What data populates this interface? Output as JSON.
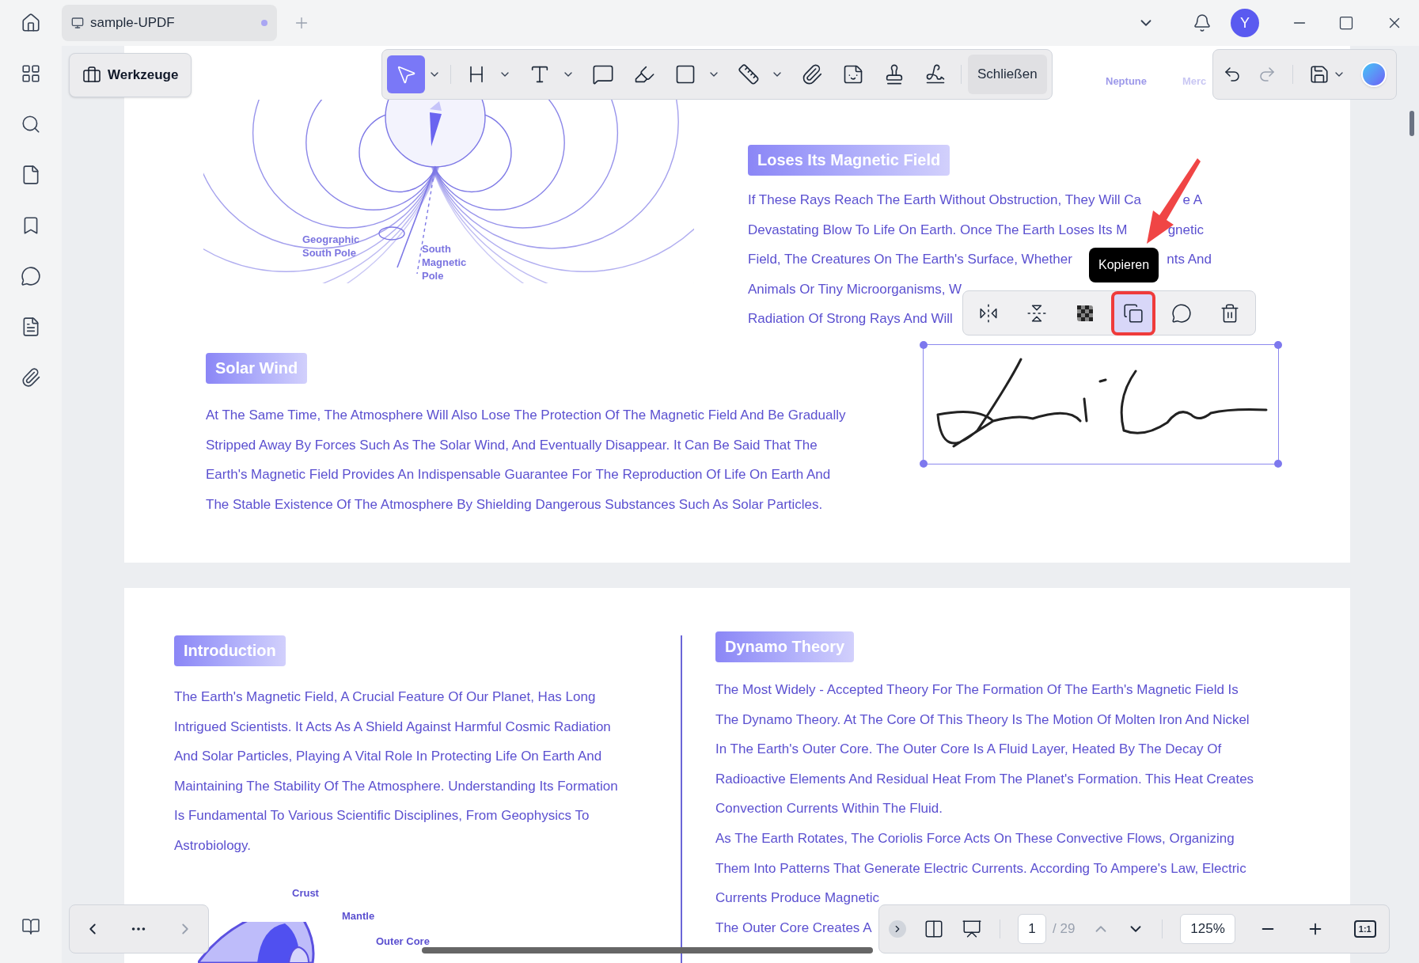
{
  "tab": {
    "title": "sample-UPDF",
    "unsaved": true
  },
  "avatar": {
    "initial": "Y"
  },
  "sidebar": {
    "items": [
      {
        "kind": "grid"
      },
      {
        "kind": "search"
      },
      {
        "kind": "page"
      },
      {
        "kind": "bookmark"
      },
      {
        "kind": "comment"
      },
      {
        "kind": "form"
      },
      {
        "kind": "attachment"
      }
    ]
  },
  "tools_button": {
    "label": "Werkzeuge"
  },
  "toolbar": {
    "tools": [
      {
        "kind": "select",
        "selected": true,
        "dropdown": true
      },
      {
        "kind": "heading",
        "selected": false,
        "dropdown": true
      },
      {
        "kind": "text",
        "selected": false,
        "dropdown": true
      },
      {
        "kind": "comment",
        "selected": false,
        "dropdown": false
      },
      {
        "kind": "highlighter",
        "selected": false,
        "dropdown": false
      },
      {
        "kind": "shape",
        "selected": false,
        "dropdown": true
      },
      {
        "kind": "measure",
        "selected": false,
        "dropdown": true
      },
      {
        "kind": "attachment",
        "selected": false,
        "dropdown": false
      },
      {
        "kind": "sticker",
        "selected": false,
        "dropdown": false
      },
      {
        "kind": "stamp",
        "selected": false,
        "dropdown": false
      },
      {
        "kind": "signature",
        "selected": false,
        "dropdown": false
      }
    ],
    "close_label": "Schließen"
  },
  "background_labels": [
    "Neptune",
    "Merc"
  ],
  "page1": {
    "diagram_labels": [
      "Geographic South Pole",
      "South Magnetic Pole"
    ],
    "right_heading": "Loses Its Magnetic Field",
    "right_lines": [
      {
        "text": "If These Rays Reach The Earth Without Obstruction, They Will Ca",
        "tail": "e A"
      },
      {
        "text": "Devastating Blow To Life On Earth. Once The Earth Loses Its M",
        "tail": "gnetic"
      },
      {
        "text": "Field, The Creatures On The Earth's Surface, Whether",
        "tail": "nts And"
      },
      {
        "text": "Animals Or Tiny Microorganisms, W"
      },
      {
        "text": "Radiation Of Strong Rays And Will"
      }
    ],
    "left_heading": "Solar Wind",
    "left_lines": [
      "At The Same Time, The Atmosphere Will Also Lose The Protection Of The Magnetic Field And Be Gradually",
      "Stripped Away By Forces Such As The Solar Wind, And Eventually Disappear. It Can Be Said That The",
      "Earth's Magnetic Field Provides An Indispensable Guarantee For The Reproduction Of Life On Earth And",
      "The Stable Existence Of The Atmosphere By Shielding Dangerous Substances Such As Solar Particles."
    ]
  },
  "selection_toolbar": {
    "actions": [
      {
        "kind": "flip-horizontal",
        "selected": false
      },
      {
        "kind": "flip-vertical",
        "selected": false
      },
      {
        "kind": "opacity",
        "selected": false
      },
      {
        "kind": "copy",
        "selected": true
      },
      {
        "kind": "comment",
        "selected": false
      },
      {
        "kind": "delete",
        "selected": false
      }
    ],
    "tooltip": "Kopieren"
  },
  "page2": {
    "left_heading": "Introduction",
    "left_lines": [
      "The Earth's Magnetic Field, A Crucial Feature Of Our Planet, Has Long",
      "Intrigued Scientists. It Acts As A Shield Against Harmful Cosmic Radiation",
      "And Solar Particles, Playing A Vital Role In Protecting Life On Earth And",
      "Maintaining The Stability Of The Atmosphere. Understanding Its Formation",
      "Is Fundamental To Various Scientific Disciplines, From Geophysics To",
      "Astrobiology."
    ],
    "diagram_labels": [
      "Crust",
      "Mantle",
      "Outer Core"
    ],
    "right_heading": "Dynamo Theory",
    "right_lines": [
      "The Most Widely - Accepted Theory For The Formation Of The Earth's Magnetic Field Is",
      "The Dynamo Theory. At The Core Of This Theory Is The Motion Of Molten Iron And Nickel",
      "In The Earth's Outer Core. The Outer Core Is A Fluid Layer, Heated By The Decay Of",
      "Radioactive Elements And Residual Heat From The Planet's Formation. This Heat Creates",
      "Convection Currents Within The Fluid.",
      "As The Earth Rotates, The Coriolis Force Acts On These Convective Flows, Organizing",
      "Them Into Patterns That Generate Electric Currents. According To Ampere's Law, Electric",
      "Currents Produce Magnetic",
      "The Outer Core Creates A"
    ]
  },
  "page_nav": {
    "page": "1",
    "total": "/ 29",
    "zoom": "125%",
    "actual_size": "1:1"
  }
}
